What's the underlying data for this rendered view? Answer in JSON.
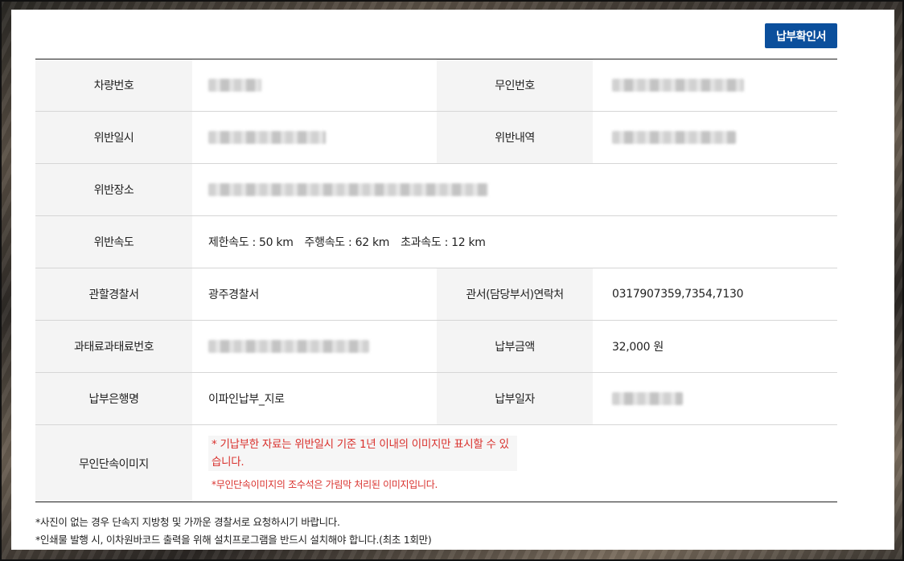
{
  "button": {
    "receipt_label": "납부확인서"
  },
  "rows": {
    "vehicle_number": {
      "label": "차량번호"
    },
    "unmanned_number": {
      "label": "무인번호"
    },
    "violation_datetime": {
      "label": "위반일시"
    },
    "violation_detail": {
      "label": "위반내역"
    },
    "violation_place": {
      "label": "위반장소"
    },
    "violation_speed": {
      "label": "위반속도",
      "limit": "제한속도 : 50 km",
      "driving": "주행속도 : 62 km",
      "excess": "초과속도 : 12 km"
    },
    "police_station": {
      "label": "관할경찰서",
      "value": "광주경찰서"
    },
    "station_contact": {
      "label": "관서(담당부서)연락처",
      "value": "0317907359,7354,7130"
    },
    "fine_number": {
      "label": "과태료과태료번호"
    },
    "payment_amount": {
      "label": "납부금액",
      "value": "32,000 원"
    },
    "payment_bank": {
      "label": "납부은행명",
      "value": "이파인납부_지로"
    },
    "payment_date": {
      "label": "납부일자"
    },
    "camera_image": {
      "label": "무인단속이미지",
      "note_main": "* 기납부한 자료는 위반일시 기준 1년 이내의 이미지만 표시할 수 있습니다.",
      "note_sub": "*무인단속이미지의 조수석은 가림막 처리된 이미지입니다."
    }
  },
  "footnotes": {
    "line1": "*사진이 없는 경우 단속지 지방청 및 가까운 경찰서로 요청하시기 바랍니다.",
    "line2": "*인쇄물 발행 시, 이차원바코드 출력을 위해 설치프로그램을 반드시 설치해야 합니다.(최초 1회만)"
  },
  "colors": {
    "button_bg": "#0b4f9c",
    "header_cell_bg": "#f4f4f4",
    "warning_text": "#d9302c"
  }
}
